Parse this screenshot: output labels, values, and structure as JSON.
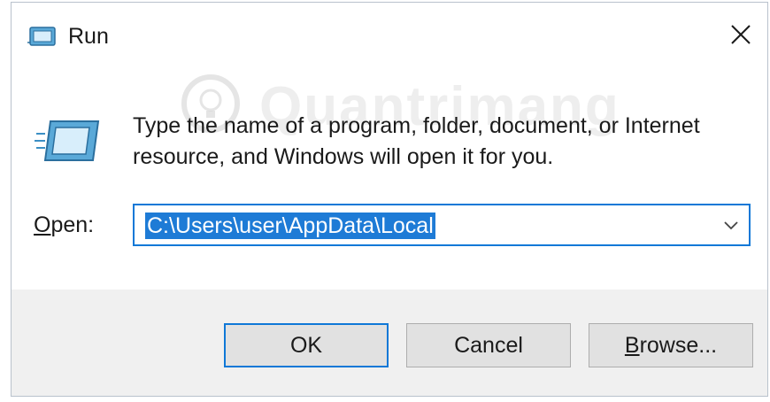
{
  "window": {
    "title": "Run",
    "icons": {
      "title": "run-icon",
      "main": "run-icon",
      "close": "close-icon",
      "dropdown": "chevron-down-icon"
    }
  },
  "content": {
    "description_line1": "Type the name of a program, folder, document, or Internet",
    "description_line2": "resource, and Windows will open it for you.",
    "open_label_first": "O",
    "open_label_rest": "pen:",
    "open_value": "C:\\Users\\user\\AppData\\Local",
    "watermark": "Quantrimang"
  },
  "buttons": {
    "ok": "OK",
    "cancel": "Cancel",
    "browse_first": "B",
    "browse_rest": "rowse..."
  },
  "colors": {
    "accent": "#0f78d7",
    "selection": "#1e7bd6",
    "footer": "#f0f0f0"
  }
}
